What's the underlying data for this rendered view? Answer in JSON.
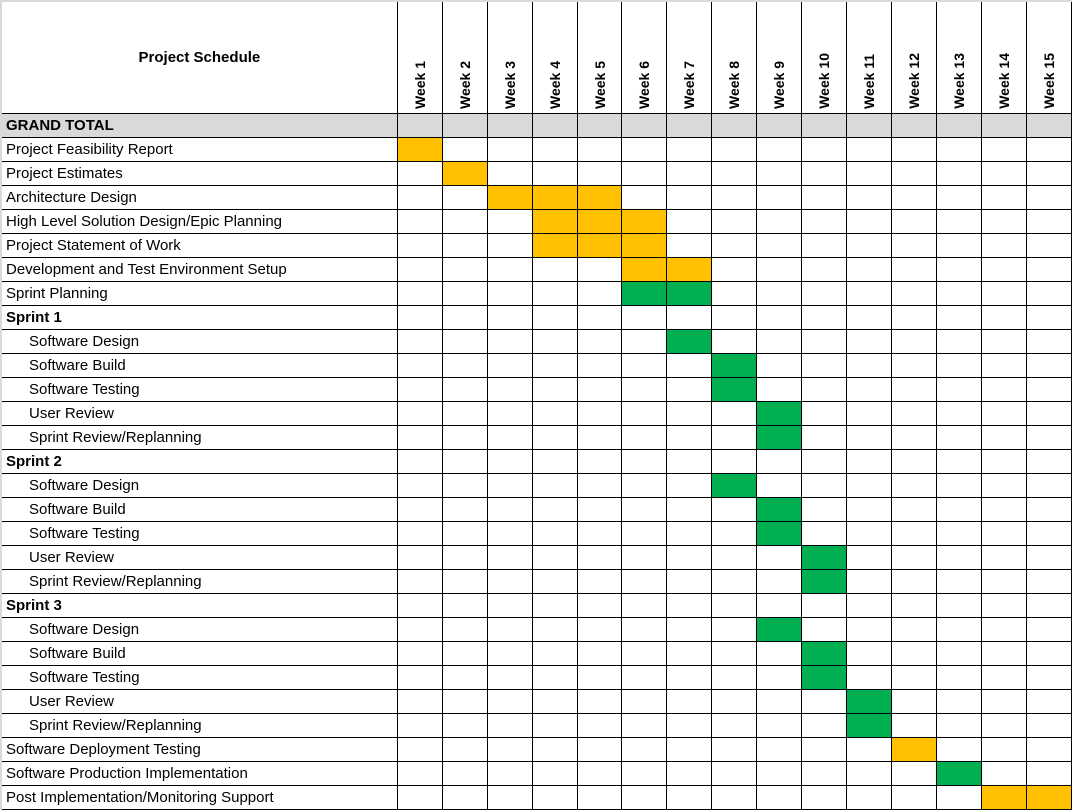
{
  "chart_data": {
    "type": "table",
    "title": "Project Schedule",
    "weeks": [
      "Week 1",
      "Week 2",
      "Week 3",
      "Week 4",
      "Week 5",
      "Week 6",
      "Week 7",
      "Week 8",
      "Week 9",
      "Week 10",
      "Week 11",
      "Week 12",
      "Week 13",
      "Week 14",
      "Week 15"
    ],
    "colors": {
      "orange": "#ffc000",
      "green": "#00b050",
      "grand_total_bg": "#d9d9d9"
    },
    "rows": [
      {
        "label": "GRAND TOTAL",
        "style": "grand",
        "weeks": [],
        "color": ""
      },
      {
        "label": "Project Feasibility Report",
        "style": "normal",
        "weeks": [
          1
        ],
        "color": "orange"
      },
      {
        "label": "Project Estimates",
        "style": "normal",
        "weeks": [
          2
        ],
        "color": "orange"
      },
      {
        "label": "Architecture Design",
        "style": "normal",
        "weeks": [
          3,
          4,
          5
        ],
        "color": "orange"
      },
      {
        "label": "High Level Solution Design/Epic Planning",
        "style": "normal",
        "weeks": [
          4,
          5,
          6
        ],
        "color": "orange"
      },
      {
        "label": "Project Statement of Work",
        "style": "normal",
        "weeks": [
          4,
          5,
          6
        ],
        "color": "orange"
      },
      {
        "label": "Development and Test Environment Setup",
        "style": "normal",
        "weeks": [
          6,
          7
        ],
        "color": "orange"
      },
      {
        "label": "Sprint Planning",
        "style": "normal",
        "weeks": [
          6,
          7
        ],
        "color": "green"
      },
      {
        "label": "Sprint 1",
        "style": "bold",
        "weeks": [],
        "color": ""
      },
      {
        "label": "Software Design",
        "style": "indent",
        "weeks": [
          7
        ],
        "color": "green"
      },
      {
        "label": "Software Build",
        "style": "indent",
        "weeks": [
          8
        ],
        "color": "green"
      },
      {
        "label": "Software Testing",
        "style": "indent",
        "weeks": [
          8
        ],
        "color": "green"
      },
      {
        "label": "User Review",
        "style": "indent",
        "weeks": [
          9
        ],
        "color": "green"
      },
      {
        "label": "Sprint Review/Replanning",
        "style": "indent",
        "weeks": [
          9
        ],
        "color": "green"
      },
      {
        "label": "Sprint 2",
        "style": "bold",
        "weeks": [],
        "color": ""
      },
      {
        "label": "Software Design",
        "style": "indent",
        "weeks": [
          8
        ],
        "color": "green"
      },
      {
        "label": "Software Build",
        "style": "indent",
        "weeks": [
          9
        ],
        "color": "green"
      },
      {
        "label": "Software Testing",
        "style": "indent",
        "weeks": [
          9
        ],
        "color": "green"
      },
      {
        "label": "User Review",
        "style": "indent",
        "weeks": [
          10
        ],
        "color": "green"
      },
      {
        "label": "Sprint Review/Replanning",
        "style": "indent",
        "weeks": [
          10
        ],
        "color": "green"
      },
      {
        "label": "Sprint 3",
        "style": "bold",
        "weeks": [],
        "color": ""
      },
      {
        "label": "Software Design",
        "style": "indent",
        "weeks": [
          9
        ],
        "color": "green"
      },
      {
        "label": "Software Build",
        "style": "indent",
        "weeks": [
          10
        ],
        "color": "green"
      },
      {
        "label": "Software Testing",
        "style": "indent",
        "weeks": [
          10
        ],
        "color": "green"
      },
      {
        "label": "User Review",
        "style": "indent",
        "weeks": [
          11
        ],
        "color": "green"
      },
      {
        "label": "Sprint Review/Replanning",
        "style": "indent",
        "weeks": [
          11
        ],
        "color": "green"
      },
      {
        "label": "Software Deployment Testing",
        "style": "normal",
        "weeks": [
          12
        ],
        "color": "orange"
      },
      {
        "label": "Software Production Implementation",
        "style": "normal",
        "weeks": [
          13
        ],
        "color": "green"
      },
      {
        "label": "Post Implementation/Monitoring Support",
        "style": "normal",
        "weeks": [
          14,
          15
        ],
        "color": "orange"
      }
    ]
  }
}
